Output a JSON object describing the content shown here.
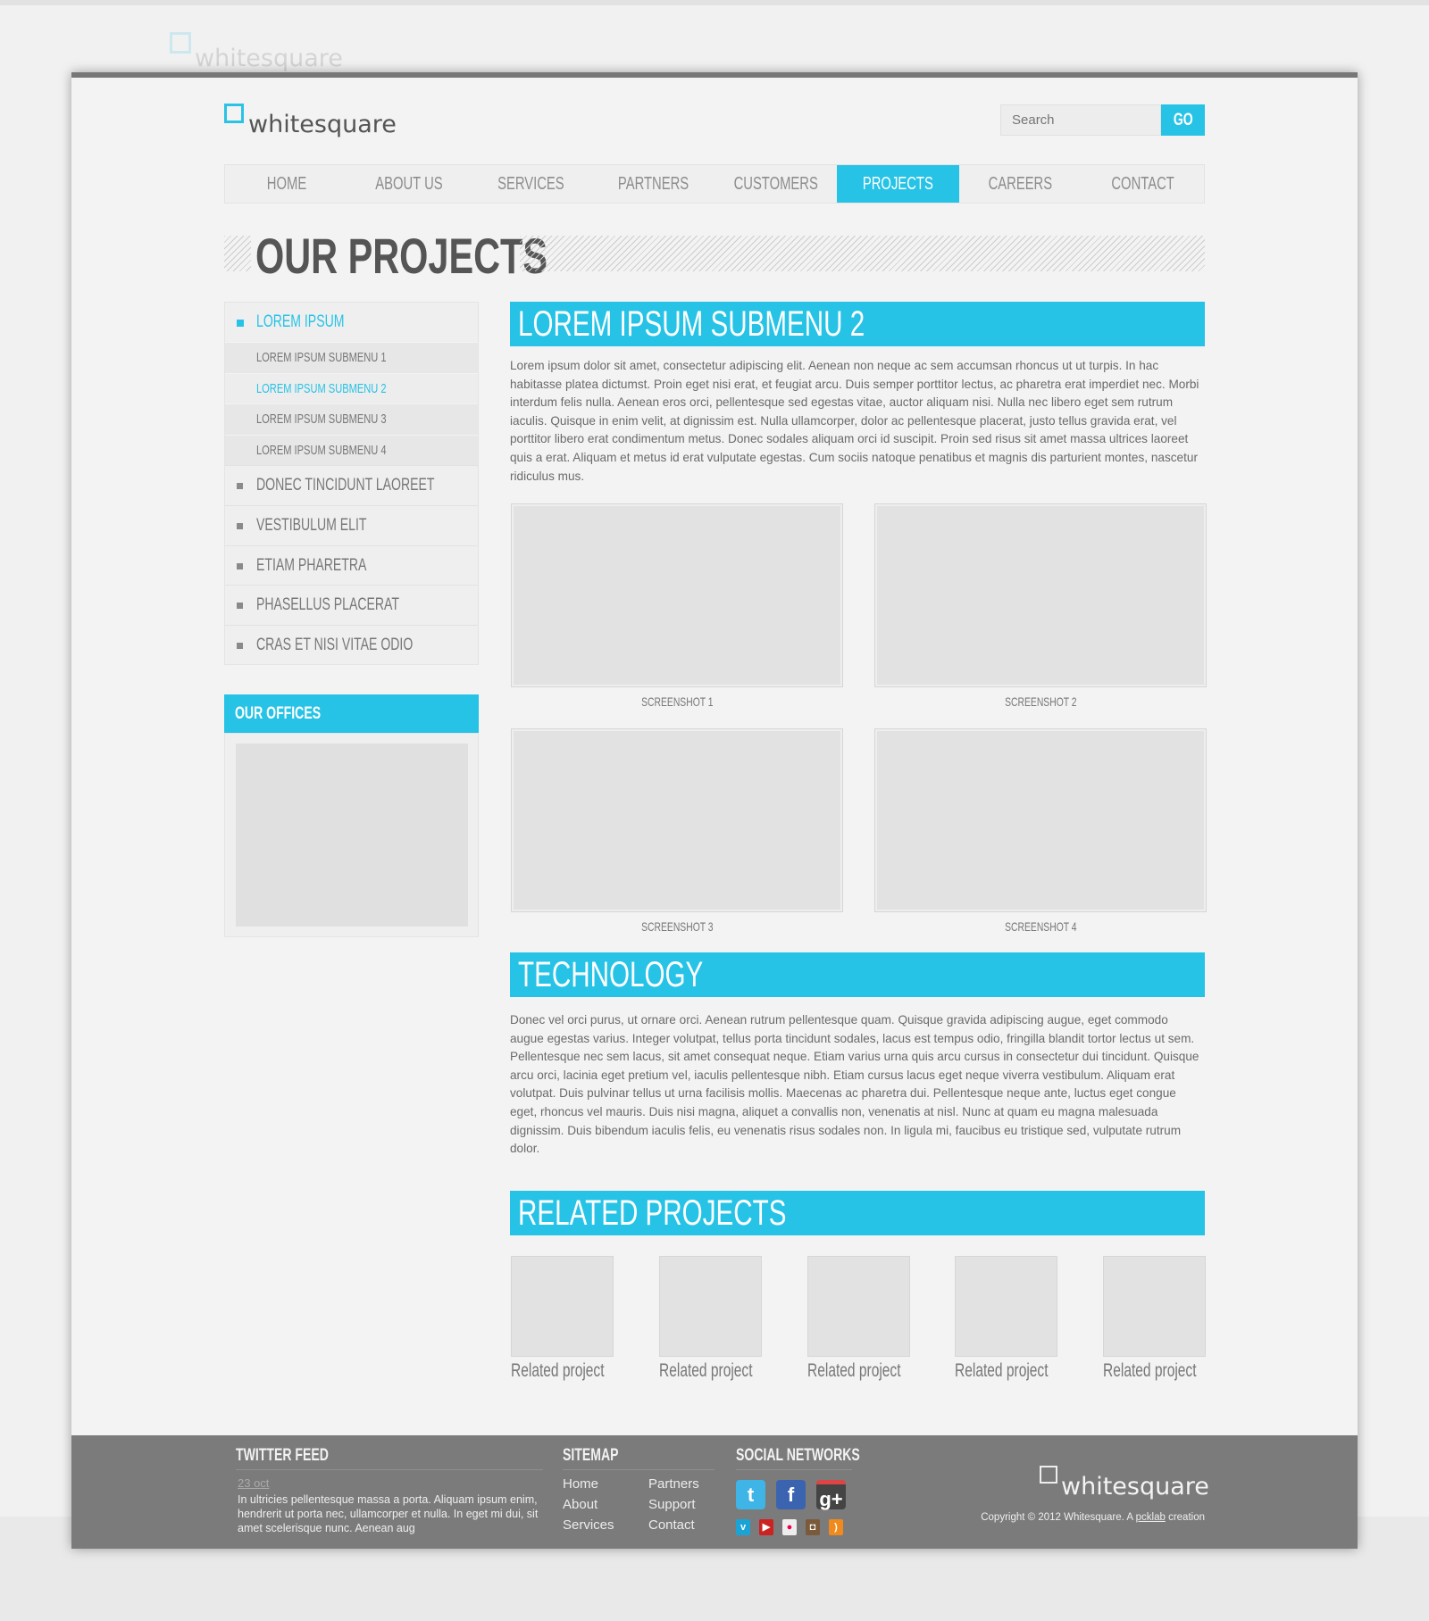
{
  "logo": {
    "text": "whitesquare"
  },
  "search": {
    "placeholder": "Search",
    "button": "GO"
  },
  "nav": [
    {
      "label": "HOME"
    },
    {
      "label": "ABOUT US"
    },
    {
      "label": "SERVICES"
    },
    {
      "label": "PARTNERS"
    },
    {
      "label": "CUSTOMERS"
    },
    {
      "label": "PROJECTS",
      "active": true
    },
    {
      "label": "CAREERS"
    },
    {
      "label": "CONTACT"
    }
  ],
  "page_title": "OUR PROJECTS",
  "sidebar": {
    "top": "LOREM IPSUM",
    "subitems": [
      "LOREM IPSUM SUBMENU 1",
      "LOREM IPSUM SUBMENU 2",
      "LOREM IPSUM SUBMENU 3",
      "LOREM IPSUM SUBMENU 4"
    ],
    "items": [
      "DONEC TINCIDUNT LAOREET",
      "VESTIBULUM ELIT",
      "ETIAM PHARETRA",
      "PHASELLUS PLACERAT",
      "CRAS ET NISI VITAE ODIO"
    ],
    "offices_title": "OUR OFFICES"
  },
  "main": {
    "section1_title": "LOREM IPSUM SUBMENU 2",
    "section1_text": "Lorem ipsum dolor sit amet, consectetur adipiscing elit. Aenean non neque ac sem accumsan rhoncus ut ut turpis. In hac habitasse platea dictumst. Proin eget nisi erat, et feugiat arcu. Duis semper porttitor lectus, ac pharetra erat imperdiet nec. Morbi interdum felis nulla. Aenean eros orci, pellentesque sed egestas vitae, auctor aliquam nisi. Nulla nec libero eget sem rutrum iaculis. Quisque in enim velit, at dignissim est. Nulla ullamcorper, dolor ac pellentesque placerat, justo tellus gravida erat, vel porttitor libero erat condimentum metus. Donec sodales aliquam orci id suscipit. Proin sed risus sit amet massa ultrices laoreet quis a erat. Aliquam et metus id erat vulputate egestas. Cum sociis natoque penatibus et magnis dis parturient montes, nascetur ridiculus mus.",
    "screenshots": [
      "SCREENSHOT 1",
      "SCREENSHOT 2",
      "SCREENSHOT 3",
      "SCREENSHOT 4"
    ],
    "section2_title": "TECHNOLOGY",
    "section2_text": "Donec vel orci purus, ut ornare orci. Aenean rutrum pellentesque quam. Quisque gravida adipiscing augue, eget commodo augue egestas varius. Integer volutpat, tellus porta tincidunt sodales, lacus est tempus odio, fringilla blandit tortor lectus ut sem. Pellentesque nec sem lacus, sit amet consequat neque. Etiam varius urna quis arcu cursus in consectetur dui tincidunt. Quisque arcu orci, lacinia eget pretium vel, iaculis pellentesque nibh. Etiam cursus lacus eget neque viverra vestibulum. Aliquam erat volutpat. Duis pulvinar tellus ut urna facilisis mollis. Maecenas ac pharetra dui. Pellentesque neque ante, luctus eget congue eget, rhoncus vel mauris. Duis nisi magna, aliquet a convallis non, venenatis at nisl. Nunc at quam eu magna malesuada dignissim. Duis bibendum iaculis felis, eu venenatis risus sodales non. In ligula mi, faucibus eu tristique sed, vulputate rutrum dolor.",
    "section3_title": "RELATED PROJECTS",
    "related": [
      "Related project",
      "Related project",
      "Related project",
      "Related project",
      "Related project"
    ]
  },
  "footer": {
    "twitter_title": "TWITTER FEED",
    "tweet_date": "23 oct",
    "tweet_text": "In ultricies pellentesque massa a porta. Aliquam ipsum enim, hendrerit ut porta nec, ullamcorper et nulla. In eget mi dui, sit amet scelerisque nunc. Aenean aug",
    "sitemap_title": "SITEMAP",
    "sitemap_col1": [
      "Home",
      "About",
      "Services"
    ],
    "sitemap_col2": [
      "Partners",
      "Support",
      "Contact"
    ],
    "social_title": "SOCIAL NETWORKS",
    "social_big": [
      "twitter-icon",
      "facebook-icon",
      "google-plus-icon"
    ],
    "social_small": [
      "vimeo-icon",
      "youtube-icon",
      "flickr-icon",
      "instagram-icon",
      "rss-icon"
    ],
    "logo": "whitesquare",
    "copyright_prefix": "Copyright © 2012 Whitesquare. A ",
    "copyright_link": "pcklab",
    "copyright_suffix": " creation"
  },
  "colors": {
    "accent": "#26c3e6",
    "footer": "#7b7b7b",
    "text": "#6a6a6a"
  }
}
